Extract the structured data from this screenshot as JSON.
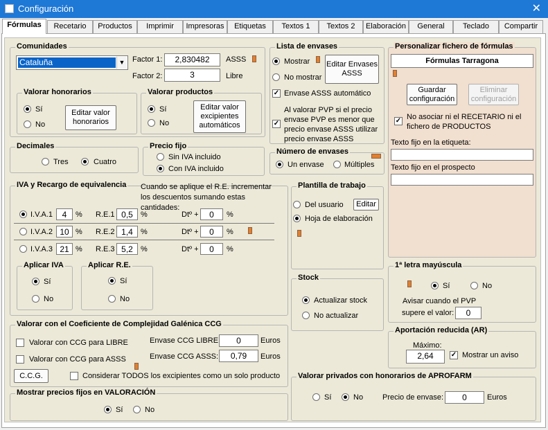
{
  "window": {
    "title": "Configuración",
    "close": "✕"
  },
  "tabs": [
    "Fórmulas",
    "Recetario",
    "Productos",
    "Imprimir",
    "Impresoras",
    "Etiquetas",
    "Textos 1",
    "Textos 2",
    "Elaboración",
    "General",
    "Teclado",
    "Compartir"
  ],
  "comunidades": {
    "title": "Comunidades",
    "selected": "Cataluña",
    "factor1_label": "Factor 1:",
    "factor1": "2,830482",
    "factor1_unit": "ASSS",
    "factor2_label": "Factor 2:",
    "factor2": "3",
    "factor2_unit": "Libre"
  },
  "honorarios": {
    "title": "Valorar honorarios",
    "si": "Sí",
    "no": "No",
    "button": "Editar valor honorarios"
  },
  "vproductos": {
    "title": "Valorar productos",
    "si": "Sí",
    "no": "No",
    "button": "Editar valor excipientes automáticos"
  },
  "envases": {
    "title": "Lista de envases",
    "mostrar": "Mostrar",
    "no_mostrar": "No mostrar",
    "button": "Editar Envases ASSS",
    "auto": "Envase ASSS automático",
    "pvp_text": "Al valorar PVP si el precio envase PVP es menor que precio envase ASSS utilizar precio envase ASSS"
  },
  "num_envases": {
    "title": "Número de envases",
    "un": "Un envase",
    "multiples": "Múltiples"
  },
  "decimales": {
    "title": "Decimales",
    "tres": "Tres",
    "cuatro": "Cuatro"
  },
  "precio_fijo": {
    "title": "Precio fijo",
    "sin": "Sin IVA incluido",
    "con": "Con IVA incluido"
  },
  "iva": {
    "title": "IVA y Recargo de equivalencia",
    "note": "Cuando se aplique el R.E. incrementar los descuentos sumando estas cantidades:",
    "rows": [
      {
        "iva": "I.V.A.1",
        "iva_val": "4",
        "re": "R.E.1",
        "re_val": "0,5",
        "dto": "Dtº +",
        "dto_val": "0"
      },
      {
        "iva": "I.V.A.2",
        "iva_val": "10",
        "re": "R.E.2",
        "re_val": "1,4",
        "dto": "Dtº +",
        "dto_val": "0"
      },
      {
        "iva": "I.V.A.3",
        "iva_val": "21",
        "re": "R.E.3",
        "re_val": "5,2",
        "dto": "Dtº +",
        "dto_val": "0"
      }
    ],
    "pct": "%",
    "aplicar_iva": "Aplicar IVA",
    "aplicar_re": "Aplicar R.E.",
    "si": "Sí",
    "no": "No"
  },
  "plantilla": {
    "title": "Plantilla de trabajo",
    "del_usuario": "Del usuario",
    "editar": "Editar",
    "hoja": "Hoja de elaboración"
  },
  "stock": {
    "title": "Stock",
    "actualizar": "Actualizar stock",
    "no_actualizar": "No actualizar"
  },
  "ccg": {
    "title": "Valorar con el Coeficiente de Complejidad Galénica CCG",
    "libre": "Valorar con CCG para LIBRE",
    "asss": "Valorar con CCG para ASSS",
    "env_libre_label": "Envase CCG LIBRE:",
    "env_libre": "0",
    "env_asss_label": "Envase CCG ASSS:",
    "env_asss": "0,79",
    "euros": "Euros",
    "button": "C.C.G.",
    "todos": "Considerar TODOS los excipientes como un solo producto"
  },
  "mostrar_precios": {
    "title": "Mostrar precios fijos en VALORACIÓN",
    "si": "Sí",
    "no": "No"
  },
  "aprofarm": {
    "title": "Valorar privados con honorarios de APROFARM",
    "si": "Sí",
    "no": "No",
    "precio_label": "Precio de envase:",
    "precio": "0",
    "euros": "Euros"
  },
  "personalizar": {
    "title": "Personalizar fichero de fórmulas",
    "fichero": "Fórmulas Tarragona",
    "guardar": "Guardar configuración",
    "eliminar": "Eliminar configuración",
    "no_asociar": "No asociar ni el RECETARIO ni el fichero de PRODUCTOS",
    "texto_etiqueta": "Texto fijo en la etiqueta:",
    "texto_prospecto": "Texto fijo en el prospecto"
  },
  "mayuscula": {
    "title": "1ª letra mayúscula",
    "si": "Sí",
    "no": "No",
    "avisar": "Avisar cuando el PVP",
    "supere": "supere el valor:",
    "valor": "0"
  },
  "ar": {
    "title": "Aportación reducida (AR)",
    "maximo": "Máximo:",
    "valor": "2,64",
    "aviso": "Mostrar un aviso"
  },
  "colors": {
    "titlebar": "#1e78d6",
    "panel": "#ece9d8",
    "selection": "#0a64c8",
    "personal_bg": "#f1dfcf"
  }
}
